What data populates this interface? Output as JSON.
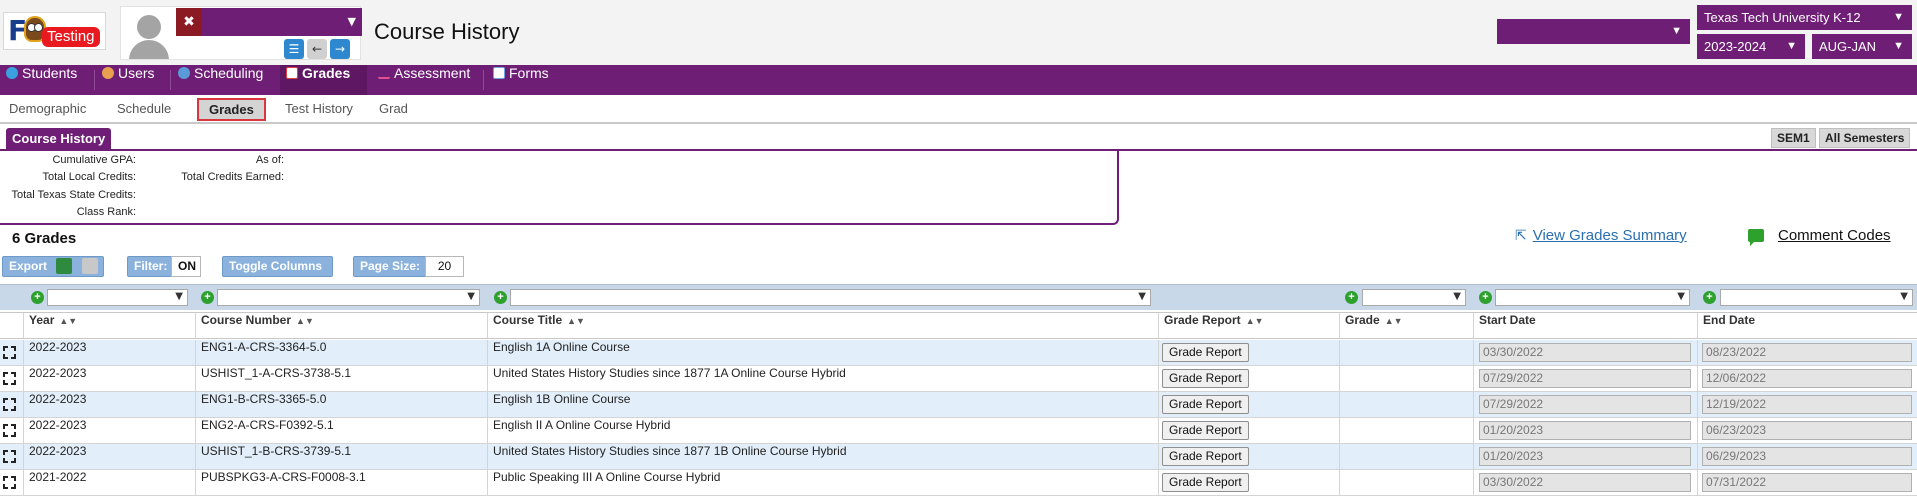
{
  "logo": {
    "letter": "F",
    "badge": "Testing"
  },
  "header": {
    "title": "Course History",
    "district": "Texas Tech University K-12",
    "year": "2023-2024",
    "term": "AUG-JAN",
    "x_label": "✖"
  },
  "main_nav": [
    {
      "label": "Students",
      "icon": "students-icon",
      "color": "#3aa0e0"
    },
    {
      "label": "Users",
      "icon": "users-icon",
      "color": "#e8a050"
    },
    {
      "label": "Scheduling",
      "icon": "scheduling-icon",
      "color": "#5a9ad8"
    },
    {
      "label": "Grades",
      "icon": "grades-icon",
      "color": "#e04040",
      "active": true
    },
    {
      "label": "Assessment",
      "icon": "assessment-icon",
      "color": "#e05090"
    },
    {
      "label": "Forms",
      "icon": "forms-icon",
      "color": "#70a8e0"
    }
  ],
  "sub_nav": [
    "Demographic",
    "Schedule",
    "Grades",
    "Test History",
    "Grad"
  ],
  "section": {
    "tab": "Course History",
    "sem1": "SEM1",
    "all_semesters": "All Semesters"
  },
  "summary": {
    "cumulative_gpa": "Cumulative GPA:",
    "as_of": "As of:",
    "total_local_credits": "Total Local Credits:",
    "total_credits_earned": "Total Credits Earned:",
    "total_texas_state_credits": "Total Texas State Credits:",
    "class_rank": "Class Rank:"
  },
  "grades_count": "6 Grades",
  "links": {
    "view_summary": "View Grades Summary",
    "comment_codes": "Comment Codes"
  },
  "toolbar": {
    "export": "Export",
    "filter": "Filter:",
    "filter_value": "ON",
    "toggle_columns": "Toggle Columns",
    "page_size": "Page Size:",
    "page_size_value": "20"
  },
  "columns": [
    "Year",
    "Course Number",
    "Course Title",
    "Grade Report",
    "Grade",
    "Start Date",
    "End Date"
  ],
  "rows": [
    {
      "year": "2022-2023",
      "course_number": "ENG1-A-CRS-3364-5.0",
      "course_title": "English 1A Online Course",
      "grade_report": "Grade Report",
      "grade": "",
      "start": "03/30/2022",
      "end": "08/23/2022"
    },
    {
      "year": "2022-2023",
      "course_number": "USHIST_1-A-CRS-3738-5.1",
      "course_title": "United States History Studies since 1877 1A Online Course Hybrid",
      "grade_report": "Grade Report",
      "grade": "",
      "start": "07/29/2022",
      "end": "12/06/2022"
    },
    {
      "year": "2022-2023",
      "course_number": "ENG1-B-CRS-3365-5.0",
      "course_title": "English 1B Online Course",
      "grade_report": "Grade Report",
      "grade": "",
      "start": "07/29/2022",
      "end": "12/19/2022"
    },
    {
      "year": "2022-2023",
      "course_number": "ENG2-A-CRS-F0392-5.1",
      "course_title": "English II A Online Course Hybrid",
      "grade_report": "Grade Report",
      "grade": "",
      "start": "01/20/2023",
      "end": "06/23/2023"
    },
    {
      "year": "2022-2023",
      "course_number": "USHIST_1-B-CRS-3739-5.1",
      "course_title": "United States History Studies since 1877 1B Online Course Hybrid",
      "grade_report": "Grade Report",
      "grade": "",
      "start": "01/20/2023",
      "end": "06/29/2023"
    },
    {
      "year": "2021-2022",
      "course_number": "PUBSPKG3-A-CRS-F0008-3.1",
      "course_title": "Public Speaking III A Online Course Hybrid",
      "grade_report": "Grade Report",
      "grade": "",
      "start": "03/30/2022",
      "end": "07/31/2022"
    }
  ]
}
